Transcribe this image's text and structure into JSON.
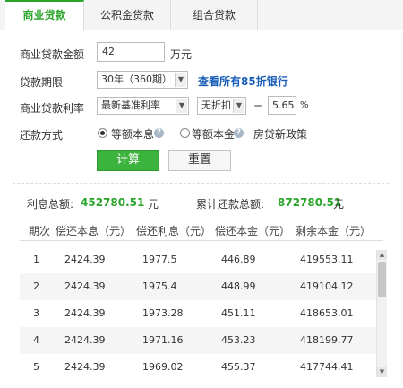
{
  "tabs": [
    {
      "label": "商业贷款"
    },
    {
      "label": "公积金贷款"
    },
    {
      "label": "组合贷款"
    }
  ],
  "form": {
    "amount_label": "商业贷款金额",
    "amount_value": "42",
    "amount_unit": "万元",
    "term_label": "贷款期限",
    "term_value": "30年（360期）",
    "discount_link": "查看所有85折银行",
    "rate_label": "商业贷款利率",
    "rate_select": "最新基准利率",
    "discount_select": "无折扣",
    "equals": "=",
    "rate_value": "5.65",
    "rate_unit": "%",
    "method_label": "还款方式",
    "method_option1": "等额本息",
    "method_option2": "等额本金",
    "policy_label": "房贷新政策",
    "selected_method": "等额本息",
    "calc_button": "计算",
    "reset_button": "重置"
  },
  "summary": {
    "interest_label": "利息总额:",
    "interest_value": "452780.51",
    "interest_unit": "元",
    "total_label": "累计还款总额:",
    "total_value": "872780.51",
    "total_unit": "元"
  },
  "table": {
    "headers": [
      "期次",
      "偿还本息（元）",
      "偿还利息（元）",
      "偿还本金（元）",
      "剩余本金（元）"
    ],
    "rows": [
      [
        "1",
        "2424.39",
        "1977.5",
        "446.89",
        "419553.11"
      ],
      [
        "2",
        "2424.39",
        "1975.4",
        "448.99",
        "419104.12"
      ],
      [
        "3",
        "2424.39",
        "1973.28",
        "451.11",
        "418653.01"
      ],
      [
        "4",
        "2424.39",
        "1971.16",
        "453.23",
        "418199.77"
      ],
      [
        "5",
        "2424.39",
        "1969.02",
        "455.37",
        "417744.41"
      ]
    ]
  },
  "colors": {
    "accent": "#2aa52a",
    "link": "#1a5db8",
    "button": "#3cb33c"
  },
  "icons": {
    "help": "help-circle-icon",
    "dropdown": "chevron-down-icon",
    "scroll_up": "arrow-up-icon",
    "scroll_down": "arrow-down-icon"
  }
}
